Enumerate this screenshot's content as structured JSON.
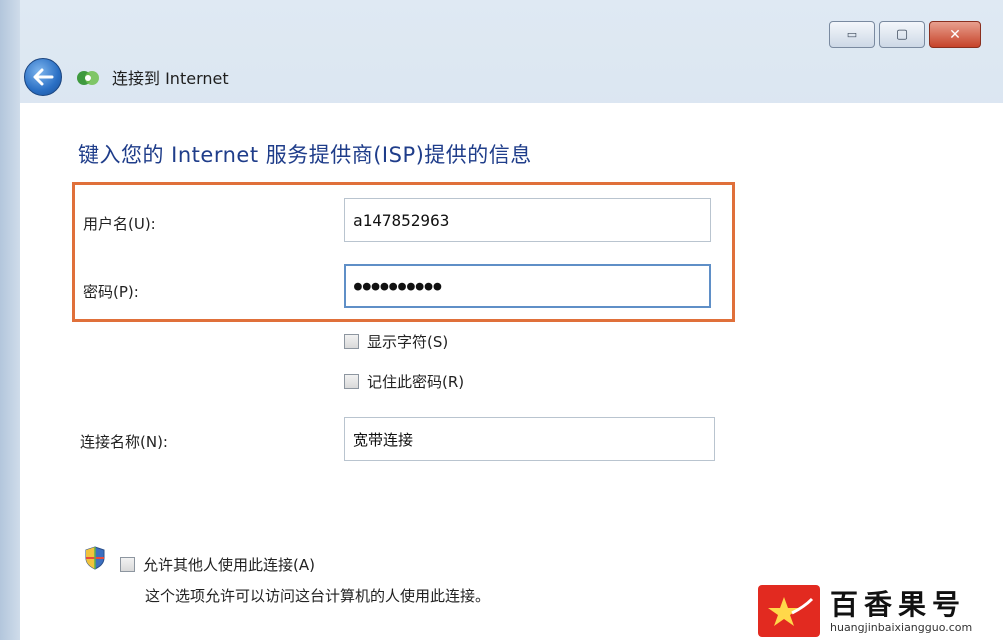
{
  "window": {
    "nav_title": "连接到 Internet",
    "controls": {
      "minimize": "▭",
      "maximize": "▢",
      "close": "✕"
    }
  },
  "form": {
    "heading": "键入您的 Internet 服务提供商(ISP)提供的信息",
    "username_label": "用户名(U):",
    "username_value": "a147852963",
    "password_label": "密码(P):",
    "password_value": "●●●●●●●●●●",
    "show_chars_label": "显示字符(S)",
    "remember_password_label": "记住此密码(R)",
    "connection_name_label": "连接名称(N):",
    "connection_name_value": "宽带连接",
    "allow_others_label": "允许其他人使用此连接(A)",
    "allow_others_note": "这个选项允许可以访问这台计算机的人使用此连接。"
  },
  "watermark": {
    "title": "百香果号",
    "url": "huangjinbaixiangguo.com"
  },
  "colors": {
    "heading": "#1f3d8a",
    "highlight": "#e0703a",
    "close_button": "#c6432a"
  }
}
